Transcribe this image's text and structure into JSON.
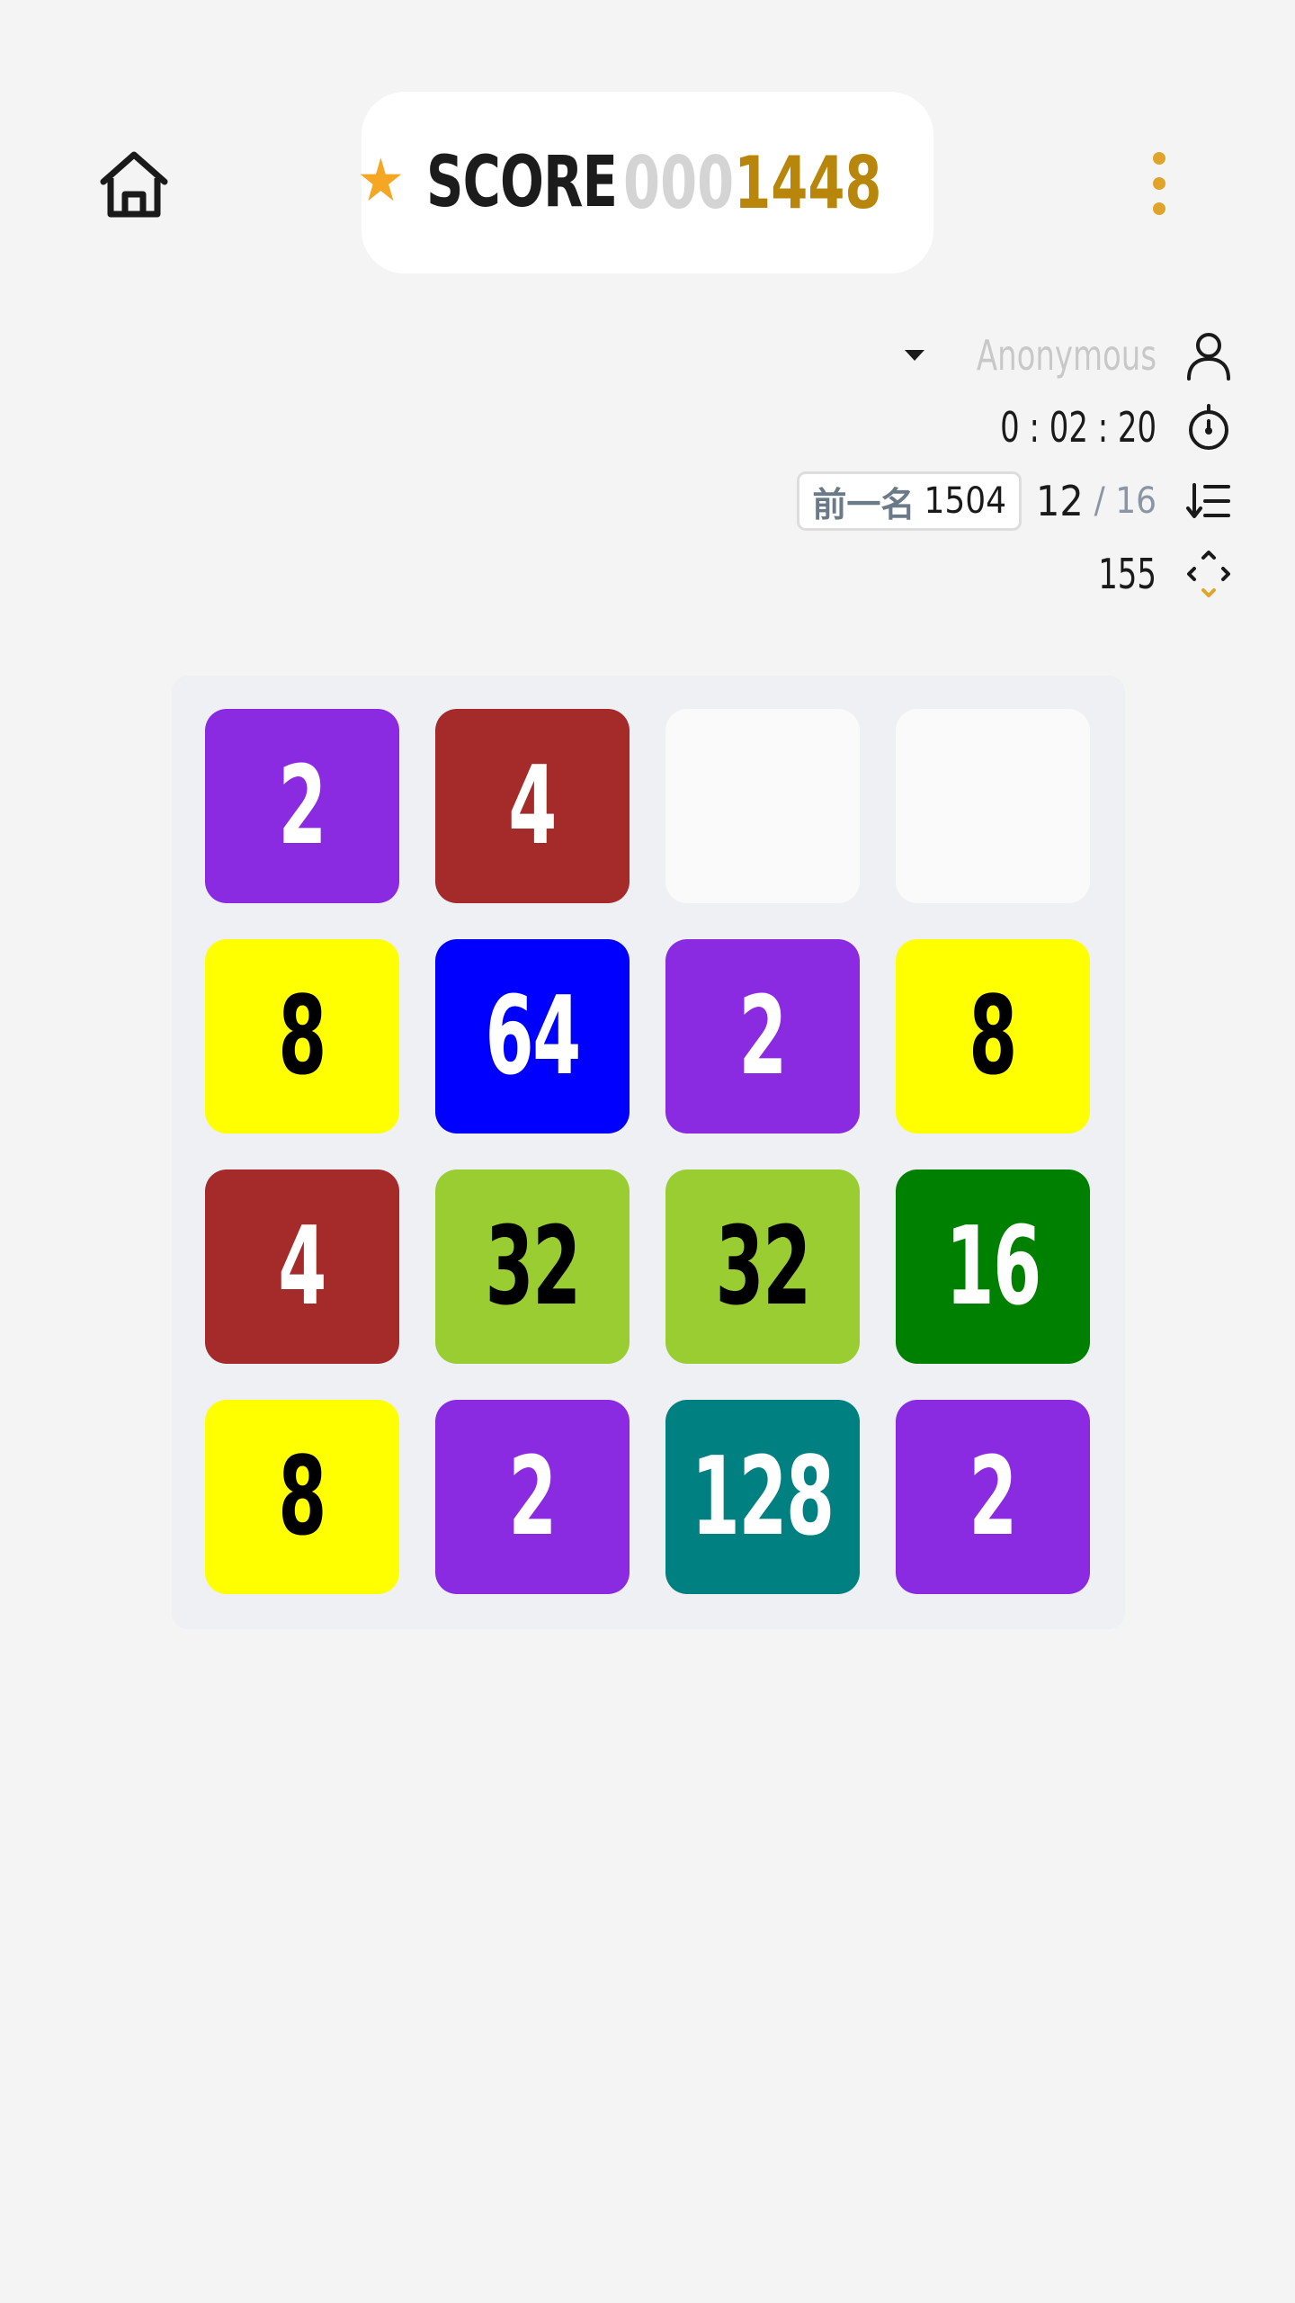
{
  "header": {
    "score_label": "SCORE",
    "score_padding": "000",
    "score_value": "1448",
    "icons": {
      "home": "home-icon",
      "star": "star-icon",
      "menu": "more-vertical-icon"
    }
  },
  "stats": {
    "player_name": "Anonymous",
    "timer": "0 : 02 : 20",
    "prev_rank_label": "前一名",
    "prev_rank_score": "1504",
    "rank_current": "12",
    "rank_total": "/ 16",
    "moves": "155",
    "icons": {
      "player": "user-icon",
      "timer": "stopwatch-icon",
      "rank": "ranking-list-icon",
      "moves": "swipe-moves-icon"
    }
  },
  "board": {
    "rows": [
      [
        {
          "value": "2",
          "bg": "#8a2be2",
          "fg": "#ffffff"
        },
        {
          "value": "4",
          "bg": "#a52a2a",
          "fg": "#ffffff"
        },
        {
          "value": "",
          "bg": "#fafafa",
          "fg": "#ffffff"
        },
        {
          "value": "",
          "bg": "#fafafa",
          "fg": "#ffffff"
        }
      ],
      [
        {
          "value": "8",
          "bg": "#ffff00",
          "fg": "#000000"
        },
        {
          "value": "64",
          "bg": "#0000ff",
          "fg": "#ffffff"
        },
        {
          "value": "2",
          "bg": "#8a2be2",
          "fg": "#ffffff"
        },
        {
          "value": "8",
          "bg": "#ffff00",
          "fg": "#000000"
        }
      ],
      [
        {
          "value": "4",
          "bg": "#a52a2a",
          "fg": "#ffffff"
        },
        {
          "value": "32",
          "bg": "#9acd32",
          "fg": "#000000"
        },
        {
          "value": "32",
          "bg": "#9acd32",
          "fg": "#000000"
        },
        {
          "value": "16",
          "bg": "#008000",
          "fg": "#ffffff"
        }
      ],
      [
        {
          "value": "8",
          "bg": "#ffff00",
          "fg": "#000000"
        },
        {
          "value": "2",
          "bg": "#8a2be2",
          "fg": "#ffffff"
        },
        {
          "value": "128",
          "bg": "#008080",
          "fg": "#ffffff"
        },
        {
          "value": "2",
          "bg": "#8a2be2",
          "fg": "#ffffff"
        }
      ]
    ]
  },
  "colors": {
    "background": "#f4f4f5",
    "accent_gold": "#b8860b",
    "star": "#f5a623",
    "menu_dots": "#e0a42a"
  }
}
